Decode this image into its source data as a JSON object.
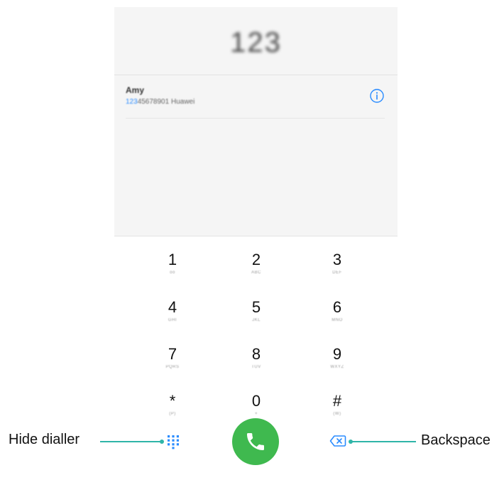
{
  "display": {
    "entered_number": "123"
  },
  "contact_match": {
    "name": "Amy",
    "matched_digits": "123",
    "number_rest": "45678901",
    "label": "Huawei"
  },
  "keypad": [
    {
      "digit": "1",
      "letters": "oo"
    },
    {
      "digit": "2",
      "letters": "ABC"
    },
    {
      "digit": "3",
      "letters": "DEF"
    },
    {
      "digit": "4",
      "letters": "GHI"
    },
    {
      "digit": "5",
      "letters": "JKL"
    },
    {
      "digit": "6",
      "letters": "MNO"
    },
    {
      "digit": "7",
      "letters": "PQRS"
    },
    {
      "digit": "8",
      "letters": "TUV"
    },
    {
      "digit": "9",
      "letters": "WXYZ"
    },
    {
      "digit": "*",
      "letters": "(P)"
    },
    {
      "digit": "0",
      "letters": "+"
    },
    {
      "digit": "#",
      "letters": "(W)"
    }
  ],
  "bottom_bar": {
    "dialpad_icon": "dialpad-grid-icon",
    "call_icon": "phone-handset-icon",
    "backspace_icon": "backspace-icon"
  },
  "callouts": {
    "hide_dialler": "Hide dialler",
    "backspace": "Backspace"
  },
  "colors": {
    "call_green": "#3fb94f",
    "accent_blue": "#2a8cff",
    "callout_teal": "#2fb5a8"
  }
}
